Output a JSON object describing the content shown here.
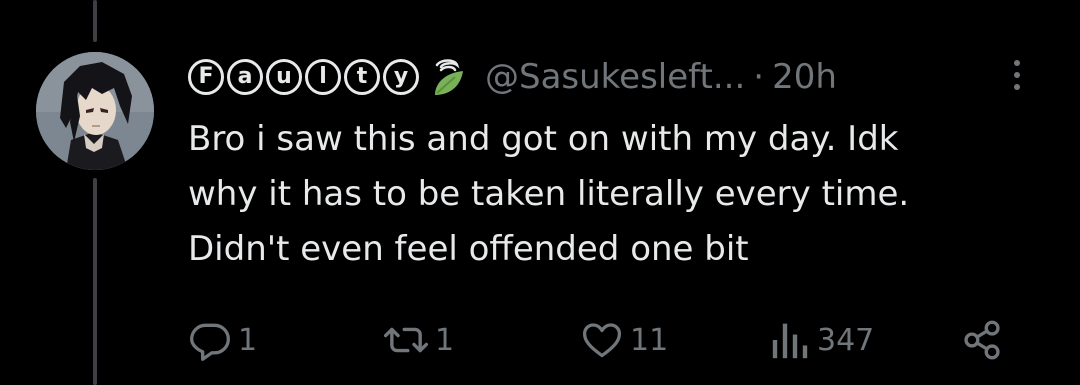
{
  "tweet": {
    "display_name_letters": [
      "F",
      "a",
      "u",
      "l",
      "t",
      "y"
    ],
    "handle": "@Sasukesleft...",
    "separator": "·",
    "time": "20h",
    "text": "Bro i saw this and got on with my day. Idk\nwhy it has to be taken literally every time.\nDidn't even feel offended one bit",
    "avatar_icon": "anime-character-avatar",
    "name_emoji": "leaf-wind-emoji"
  },
  "actions": {
    "reply_count": "1",
    "retweet_count": "1",
    "like_count": "11",
    "views_count": "347"
  },
  "colors": {
    "background": "#000000",
    "primary_text": "#e7e9ea",
    "secondary_text": "#71767b",
    "thread_line": "#3c4045",
    "leaf_green": "#78b159"
  }
}
